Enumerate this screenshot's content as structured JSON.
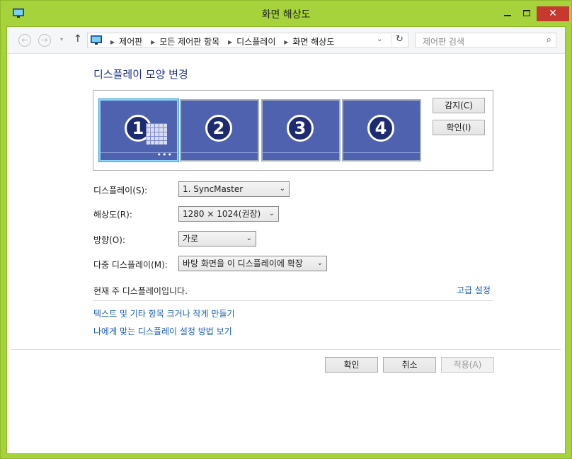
{
  "window": {
    "title": "화면 해상도",
    "close_symbol": "✕"
  },
  "nav": {
    "back_icon": "←",
    "forward_icon": "→",
    "dropdown_icon": "▾",
    "up_icon": "↑",
    "breadcrumbs": [
      "제어판",
      "모든 제어판 항목",
      "디스플레이",
      "화면 해상도"
    ],
    "breadcrumb_sep": "▶",
    "address_dropdown": "⌄",
    "refresh_icon": "↻",
    "search_placeholder": "제어판 검색",
    "search_icon": "⌕"
  },
  "main": {
    "heading": "디스플레이 모양 변경",
    "monitors": [
      {
        "number": "1",
        "selected": true
      },
      {
        "number": "2",
        "selected": false
      },
      {
        "number": "3",
        "selected": false
      },
      {
        "number": "4",
        "selected": false
      }
    ],
    "more_dots": "•••",
    "detect_label": "감지(C)",
    "identify_label": "확인(I)",
    "display_label": "디스플레이(S):",
    "display_value": "1. SyncMaster",
    "resolution_label": "해상도(R):",
    "resolution_value": "1280 × 1024(권장)",
    "orientation_label": "방향(O):",
    "orientation_value": "가로",
    "multi_label": "다중 디스플레이(M):",
    "multi_value": "바탕 화면을 이 디스플레이에 확장",
    "chevron": "⌄",
    "status_text": "현재 주 디스플레이입니다.",
    "advanced_link": "고급 설정",
    "link_text_size": "텍스트 및 기타 항목 크거나 작게 만들기",
    "link_help": "나에게 맞는 디스플레이 설정 방법 보기"
  },
  "footer": {
    "ok_label": "확인",
    "cancel_label": "취소",
    "apply_label": "적용(A)"
  }
}
